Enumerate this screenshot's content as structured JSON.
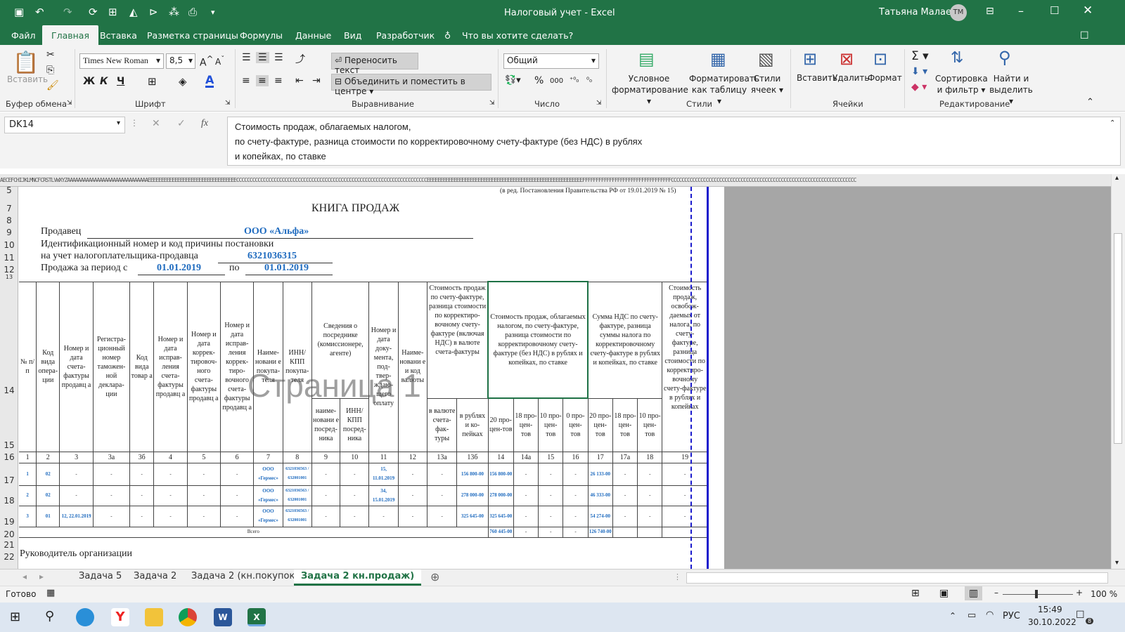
{
  "window": {
    "title": "Налоговый учет - Excel",
    "user": "Татьяна Малаева",
    "user_initials": "ТМ"
  },
  "menu": [
    "Файл",
    "Главная",
    "Вставка",
    "Разметка страницы",
    "Формулы",
    "Данные",
    "Вид",
    "Разработчик",
    "Что вы хотите сделать?"
  ],
  "ribbon": {
    "paste": "Вставить",
    "clipboard": "Буфер обмена",
    "font_name": "Times New Roman",
    "font_size": "8,5",
    "font": "Шрифт",
    "bold": "Ж",
    "italic": "К",
    "underline": "Ч",
    "wrap": "Переносить текст",
    "merge": "Объединить и поместить в центре",
    "alignment": "Выравнивание",
    "number_format": "Общий",
    "number": "Число",
    "cond1": "Условное",
    "cond2": "форматирование",
    "tbl1": "Форматировать",
    "tbl2": "как таблицу",
    "sty1": "Стили",
    "sty2": "ячеек",
    "styles": "Стили",
    "insert": "Вставить",
    "delete": "Удалить",
    "format": "Формат",
    "cells": "Ячейки",
    "sort1": "Сортировка",
    "sort2": "и фильтр",
    "find1": "Найти и",
    "find2": "выделить",
    "editing": "Редактирование"
  },
  "formula": {
    "namebox": "DK14",
    "line1": "Стоимость продаж, облагаемых налогом,",
    "line2": "по счету-фактуре, разница стоимости по корректировочному счету-фактуре (без НДС) в рублях",
    "line3": "и копейках, по ставке"
  },
  "col_header_strip": "AECEFCHIJKLMNCFCRSTLVWXYZAAAAAAAAAAAAAAAAAAAAAAAAAAAAAAEEEEEEEEEEEEEEEEEEEEEEEEEEEEEEEEECCCCCCCCCCCCCCCCCCCCCCCCCCCCCCCCCCCCCCCCCCCCCCCCCCCCCCCCCCCCCCCCCCCCCCCEEEEEEEEEEEEEEEEEEEEEEEEEEEEEEEEEEEEEEEEEEEEEEEEEEEEEEEEEEFFFFFFFFFFFFFFFFFFFFFFFFFFFFFFFFFCCCCCCCCCCCCCCCCCCCCCCCCCCCCCCCCCCCCCCCCCCCCCCCCCCCCCCCCCCCCCCCCCCCCC",
  "rows": [
    "5",
    "7",
    "8",
    "9",
    "10",
    "11",
    "12",
    "13",
    "14",
    "15",
    "16",
    "17",
    "18",
    "19",
    "20",
    "21",
    "22"
  ],
  "doc": {
    "revision": "(в ред. Постановления Правительства РФ от 19.01.2019 № 15)",
    "title": "КНИГА ПРОДАЖ",
    "seller_label": "Продавец",
    "seller": "ООО «Альфа»",
    "inn_label1": "Идентификационный номер и код причины постановки",
    "inn_label2": "на учет налогоплательщика-продавца",
    "inn": "6321036315",
    "period_label": "Продажа за период с",
    "period_from": "01.01.2019",
    "period_to_label": "по",
    "period_to": "01.01.2019",
    "watermark": "Страница 1",
    "footer": "Руководитель организации"
  },
  "table": {
    "h": [
      "№ п/п",
      "Код вида опера-ции",
      "Номер и дата счета-фактуры продавц а",
      "Регистра-ционный номер таможен-ной деклара-ции",
      "Код вида товар а",
      "Номер и дата исправ-ления счета-фактуры продавц а",
      "Номер и дата коррек-тировоч-ного счета-фактуры продавц а",
      "Номер и дата исправ-ления коррек-тиро-вочного счета-фактуры продавц а",
      "Наиме-новани е покупа-теля",
      "ИНН/ КПП покупа-теля",
      "Сведения о посреднике (комиссионере, агенте)",
      "Номер и дата доку-мента, под-твер-ждаю-щего оплату",
      "Наиме-новани е и код валюты",
      "Стоимость продаж по счету-фактуре, разница стоимости по корректиро-вочному счету-фактуре (включая НДС) в валюте счета-фактуры",
      "Стоимость продаж, облагаемых налогом, по счету-фактуре, разница стоимости по корректировочному счету-фактуре (без НДС) в рублях и копейках, по ставке",
      "Сумма НДС по счету-фактуре, разница суммы налога по корректировочному счету-фактуре в рублях и копейках, по ставке",
      "Стоимость продаж, освобож-даемых от налога, по счету-фактуре, разница стоимости по корректиро-вочному счету-фактуре в рублях и копейках"
    ],
    "sub": {
      "name": "наиме-новани е посред-ника",
      "inn": "ИНН/ КПП посред-ника",
      "cur": "в валюте счета-фак-туры",
      "rub": "в рублях и ко-пейках",
      "p20": "20 про-цен-тов",
      "p18": "18 про-цен-тов",
      "p10": "10 про-цен-тов",
      "p0": "0 про-цен-тов"
    },
    "nums": [
      "1",
      "2",
      "3",
      "3а",
      "3б",
      "4",
      "5",
      "6",
      "7",
      "8",
      "9",
      "10",
      "11",
      "12",
      "13а",
      "13б",
      "14",
      "14а",
      "15",
      "16",
      "17",
      "17а",
      "18",
      "19"
    ],
    "data": [
      {
        "n": "1",
        "code": "02",
        "inv": "-",
        "decl": "-",
        "gcode": "-",
        "fix": "-",
        "corr": "-",
        "corrfix": "-",
        "buyer": "ООО «Гермес»",
        "inn": "6321036563 / 632001001",
        "mname": "-",
        "minn": "-",
        "pay": "15, 11.01.2019",
        "cur": "-",
        "curv": "-",
        "rub": "156 800-00",
        "v20": "156 800-00",
        "v18": "-",
        "v10": "-",
        "v0": "-",
        "n20": "26 133-00",
        "n18": "-",
        "n10": "-",
        "free": "-"
      },
      {
        "n": "2",
        "code": "02",
        "inv": "-",
        "decl": "-",
        "gcode": "-",
        "fix": "-",
        "corr": "-",
        "corrfix": "-",
        "buyer": "ООО «Гермес»",
        "inn": "6321036563 / 632001001",
        "mname": "-",
        "minn": "-",
        "pay": "34, 15.01.2019",
        "cur": "-",
        "curv": "-",
        "rub": "278 000-00",
        "v20": "278 000-00",
        "v18": "-",
        "v10": "-",
        "v0": "-",
        "n20": "46 333-00",
        "n18": "-",
        "n10": "-",
        "free": "-"
      },
      {
        "n": "3",
        "code": "01",
        "inv": "12, 22.01.2019",
        "decl": "-",
        "gcode": "-",
        "fix": "-",
        "corr": "-",
        "corrfix": "-",
        "buyer": "ООО «Гермес»",
        "inn": "6321036563 / 632001001",
        "mname": "-",
        "minn": "-",
        "pay": "-",
        "cur": "-",
        "curv": "-",
        "rub": "325 645-00",
        "v20": "325 645-00",
        "v18": "-",
        "v10": "-",
        "v0": "-",
        "n20": "54 274-00",
        "n18": "-",
        "n10": "-",
        "free": "-"
      }
    ],
    "total_label": "Всего",
    "total_v20": "760 445-00",
    "total_n20": "126 740-00",
    "dash": "-"
  },
  "tabs": [
    "Задача 5",
    "Задача 2",
    "Задача 2 (кн.покупок)",
    "Задача 2 кн.продаж)"
  ],
  "status": {
    "ready": "Готово",
    "zoom": "100 %"
  },
  "taskbar": {
    "lang": "РУС",
    "time": "15:49",
    "date": "30.10.2022",
    "notif": "8"
  },
  "colors": {
    "excel_green": "#217346",
    "blue_text": "#1f6bbf"
  }
}
